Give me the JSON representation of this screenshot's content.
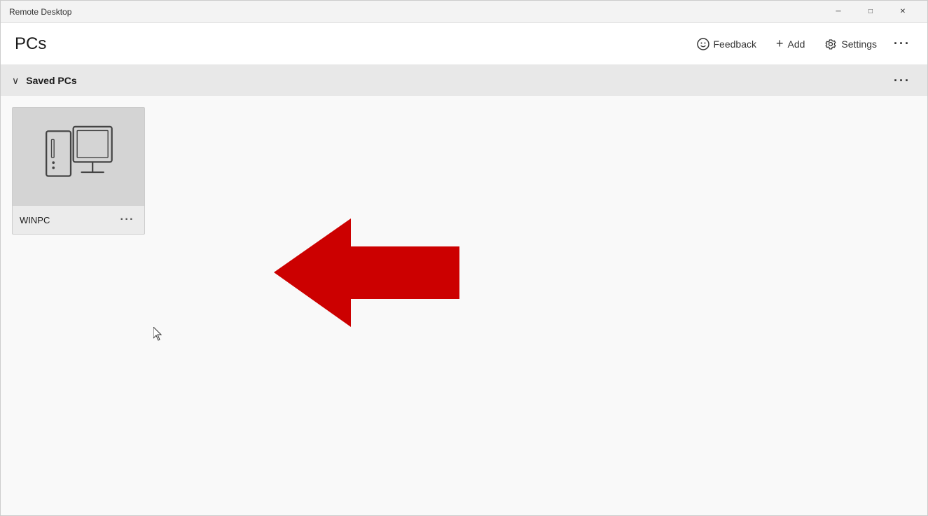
{
  "titleBar": {
    "title": "Remote Desktop",
    "controls": {
      "minimize": "─",
      "maximize": "□",
      "close": "✕"
    }
  },
  "header": {
    "title": "PCs",
    "actions": {
      "feedback": "Feedback",
      "add": "Add",
      "settings": "Settings",
      "more": "···"
    }
  },
  "section": {
    "title": "Saved PCs",
    "moreLabel": "···",
    "collapseSymbol": "∨"
  },
  "pcCard": {
    "name": "WINPC",
    "moreLabel": "···"
  }
}
